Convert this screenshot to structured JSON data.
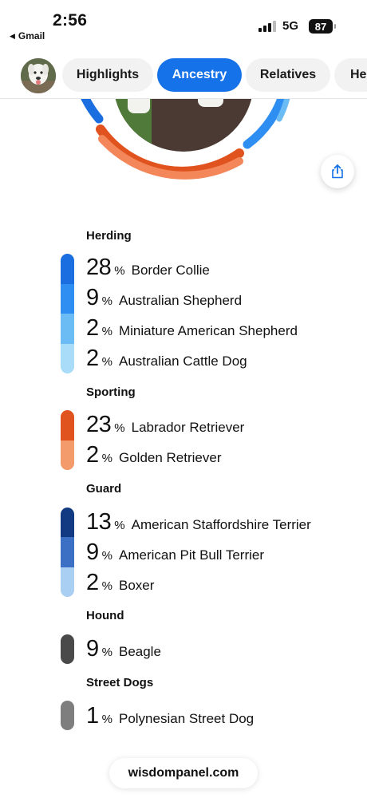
{
  "status_bar": {
    "time": "2:56",
    "back_app": "Gmail",
    "network": "5G",
    "battery": "87"
  },
  "tabs": [
    {
      "label": "Highlights",
      "active": false
    },
    {
      "label": "Ancestry",
      "active": true
    },
    {
      "label": "Relatives",
      "active": false
    },
    {
      "label": "He",
      "active": false
    }
  ],
  "icons": {
    "share": "share-icon",
    "back": "back-triangle-icon",
    "signal": "signal-bars-icon",
    "battery": "battery-icon"
  },
  "colors": {
    "accent": "#1572e8",
    "herding": [
      "#1a6ee0",
      "#2f8ef2",
      "#6bbcf5",
      "#a8dcf8"
    ],
    "sporting": [
      "#e0531f",
      "#f39b6a"
    ],
    "guard": [
      "#123a83",
      "#3b70c4",
      "#a9cff3"
    ],
    "hound": [
      "#4a4a4a"
    ],
    "street": [
      "#7e7e7e"
    ]
  },
  "groups": [
    {
      "title": "Herding",
      "breeds": [
        {
          "value": "28",
          "unit": "%",
          "name": "Border Collie"
        },
        {
          "value": "9",
          "unit": "%",
          "name": "Australian Shepherd"
        },
        {
          "value": "2",
          "unit": "%",
          "name": "Miniature American Shepherd"
        },
        {
          "value": "2",
          "unit": "%",
          "name": "Australian Cattle Dog"
        }
      ]
    },
    {
      "title": "Sporting",
      "breeds": [
        {
          "value": "23",
          "unit": "%",
          "name": "Labrador Retriever"
        },
        {
          "value": "2",
          "unit": "%",
          "name": "Golden Retriever"
        }
      ]
    },
    {
      "title": "Guard",
      "breeds": [
        {
          "value": "13",
          "unit": "%",
          "name": "American Staffordshire Terrier"
        },
        {
          "value": "9",
          "unit": "%",
          "name": "American Pit Bull Terrier"
        },
        {
          "value": "2",
          "unit": "%",
          "name": "Boxer"
        }
      ]
    },
    {
      "title": "Hound",
      "breeds": [
        {
          "value": "9",
          "unit": "%",
          "name": "Beagle"
        }
      ]
    },
    {
      "title": "Street Dogs",
      "breeds": [
        {
          "value": "1",
          "unit": "%",
          "name": "Polynesian Street Dog"
        }
      ]
    }
  ],
  "footer": {
    "domain": "wisdompanel.com"
  }
}
